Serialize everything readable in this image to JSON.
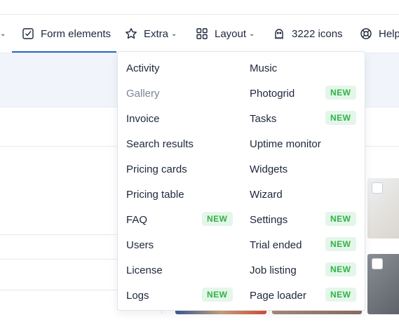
{
  "nav": {
    "items": [
      {
        "label": "Form elements",
        "icon": "checkbox-icon"
      },
      {
        "label": "Extra",
        "icon": "star-icon"
      },
      {
        "label": "Layout",
        "icon": "layout-grid-icon"
      },
      {
        "label": "3222 icons",
        "icon": "ghost-icon"
      },
      {
        "label": "Help",
        "icon": "lifebuoy-icon"
      }
    ]
  },
  "dropdown": {
    "left_column": [
      {
        "label": "Activity",
        "badge": ""
      },
      {
        "label": "Gallery",
        "badge": ""
      },
      {
        "label": "Invoice",
        "badge": ""
      },
      {
        "label": "Search results",
        "badge": ""
      },
      {
        "label": "Pricing cards",
        "badge": ""
      },
      {
        "label": "Pricing table",
        "badge": ""
      },
      {
        "label": "FAQ",
        "badge": "NEW"
      },
      {
        "label": "Users",
        "badge": ""
      },
      {
        "label": "License",
        "badge": ""
      },
      {
        "label": "Logs",
        "badge": "NEW"
      }
    ],
    "right_column": [
      {
        "label": "Music",
        "badge": ""
      },
      {
        "label": "Photogrid",
        "badge": "NEW"
      },
      {
        "label": "Tasks",
        "badge": "NEW"
      },
      {
        "label": "Uptime monitor",
        "badge": ""
      },
      {
        "label": "Widgets",
        "badge": ""
      },
      {
        "label": "Wizard",
        "badge": ""
      },
      {
        "label": "Settings",
        "badge": "NEW"
      },
      {
        "label": "Trial ended",
        "badge": "NEW"
      },
      {
        "label": "Job listing",
        "badge": "NEW"
      },
      {
        "label": "Page loader",
        "badge": "NEW"
      }
    ]
  },
  "colors": {
    "accent": "#206bc4",
    "badge_bg": "#e4f6ea",
    "badge_text": "#2fb344",
    "muted_text": "#7a8597"
  }
}
